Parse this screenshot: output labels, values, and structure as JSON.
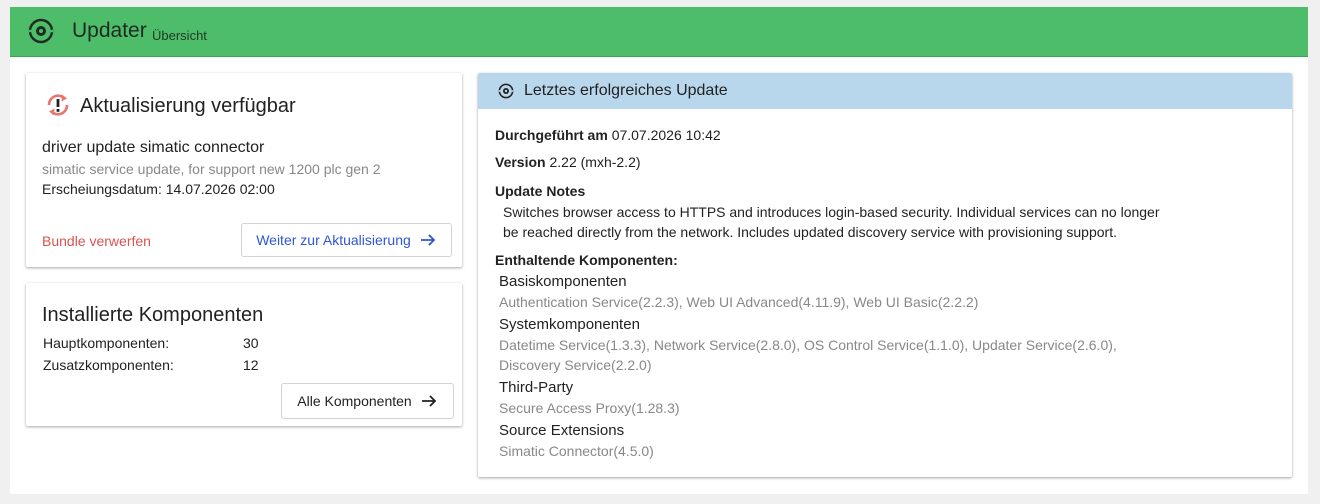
{
  "header": {
    "title": "Updater",
    "subtitle": "Übersicht",
    "logo_icon": "updater-logo-icon",
    "background": "#4dbd6a"
  },
  "available_update": {
    "icon": "sync-alert-icon",
    "heading": "Aktualisierung verfügbar",
    "name": "driver update simatic connector",
    "description": "simatic service update, for support new 1200 plc gen 2",
    "release_label": "Erscheiungsdatum:",
    "release_date": "14.07.2026 02:00",
    "discard_label": "Bundle verwerfen",
    "continue_label": "Weiter zur Aktualisierung"
  },
  "installed": {
    "heading": "Installierte Komponenten",
    "rows": [
      {
        "label": "Hauptkomponenten:",
        "value": "30"
      },
      {
        "label": "Zusatzkomponenten:",
        "value": "12"
      }
    ],
    "all_label": "Alle Komponenten"
  },
  "last_update": {
    "heading": "Letztes erfolgreiches Update",
    "performed_label": "Durchgeführt am",
    "performed_value": "07.07.2026 10:42",
    "version_label": "Version",
    "version_value": "2.22 (mxh-2.2)",
    "notes_label": "Update Notes",
    "notes_line1": "Switches browser access to HTTPS and introduces login-based security. Individual services can no longer",
    "notes_line2": "be reached directly from the network. Includes updated discovery service with provisioning support.",
    "components_label": "Enthaltende Komponenten:",
    "groups": [
      {
        "title": "Basiskomponenten",
        "items": "Authentication Service(2.2.3), Web UI Advanced(4.11.9), Web UI Basic(2.2.2)"
      },
      {
        "title": "Systemkomponenten",
        "items_line1": "Datetime Service(1.3.3), Network Service(2.8.0), OS Control Service(1.1.0), Updater Service(2.6.0),",
        "items_line2": "Discovery Service(2.2.0)"
      },
      {
        "title": "Third-Party",
        "items": "Secure Access Proxy(1.28.3)"
      },
      {
        "title": "Source Extensions",
        "items": "Simatic Connector(4.5.0)"
      }
    ]
  },
  "colors": {
    "header_green": "#4dbd6a",
    "panel_blue": "#b9d7ec",
    "danger": "#d9534f",
    "link_blue": "#2f55d4",
    "update_icon": "#e8766f"
  }
}
